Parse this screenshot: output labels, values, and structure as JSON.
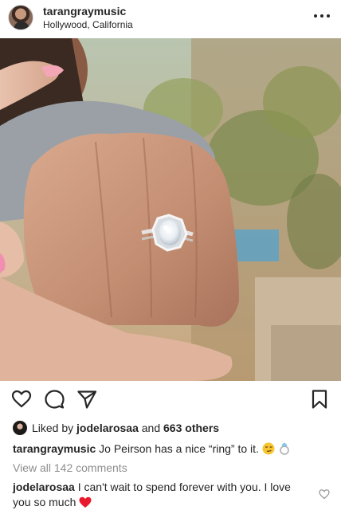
{
  "header": {
    "username": "tarangraymusic",
    "location": "Hollywood, California"
  },
  "likes": {
    "prefix": "Liked by",
    "liker": "jodelarosaa",
    "connector": "and",
    "others": "663 others"
  },
  "caption": {
    "username": "tarangraymusic",
    "text": "Jo Peirson has a nice “ring” to it. "
  },
  "comments": {
    "view_all": "View all 142 comments"
  },
  "top_comment": {
    "username": "jodelarosaa",
    "text": " I can't wait to spend forever with you. I love you so much "
  },
  "icons": {
    "more": "more-options-icon",
    "like": "heart-icon",
    "comment": "comment-bubble-icon",
    "share": "paper-plane-icon",
    "save": "bookmark-icon"
  }
}
